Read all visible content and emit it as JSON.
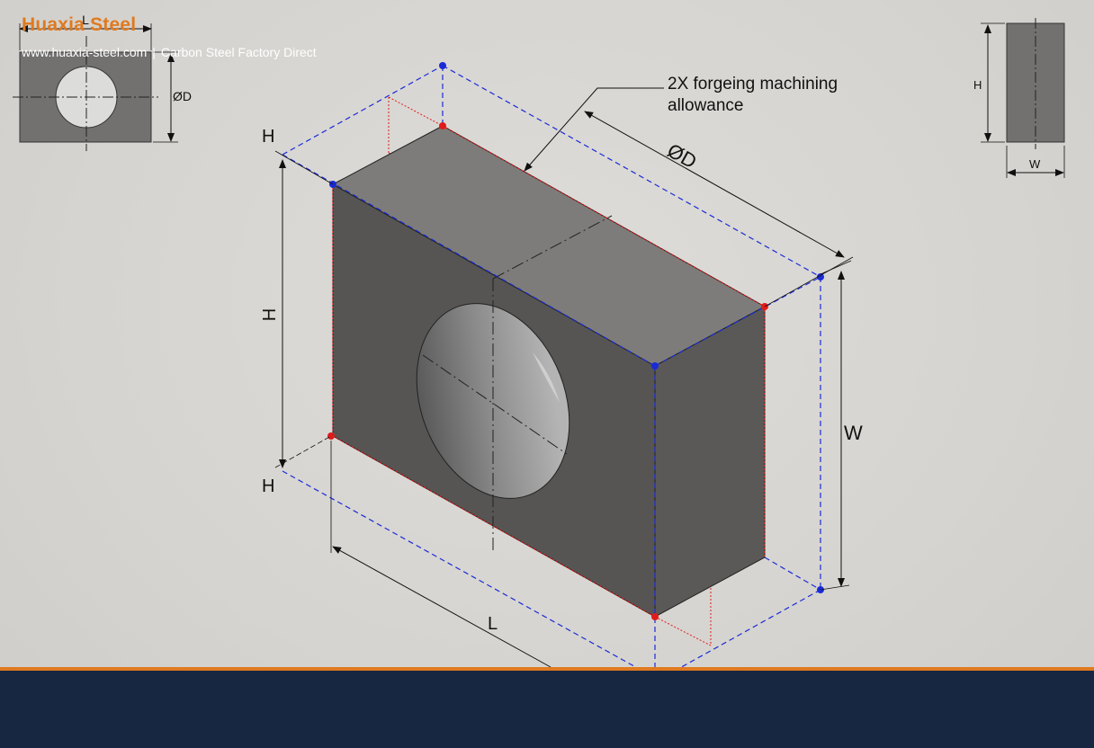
{
  "brand": {
    "name": "Huaxia Steel",
    "website": "www.huaxia-steel.com",
    "separator": "|",
    "slogan": "Carbon Steel Factory Direct"
  },
  "diagram": {
    "annotation_line1": "2X forgeing machining",
    "annotation_line2": "allowance",
    "dim_diameter": "ØD",
    "dim_height": "H",
    "dim_width": "W",
    "dim_length": "L",
    "side_view_height": "H",
    "side_view_width": "W",
    "front_view_length": "L",
    "front_view_diameter": "ØD",
    "colors": {
      "allowance_outline": "#1a2bd6",
      "finished_outline": "#e01b1b",
      "body_dark": "#565553",
      "body_top": "#7d7c7a",
      "background": "#d8d6d2",
      "accent": "#e07a1f",
      "footer": "#172641"
    }
  }
}
